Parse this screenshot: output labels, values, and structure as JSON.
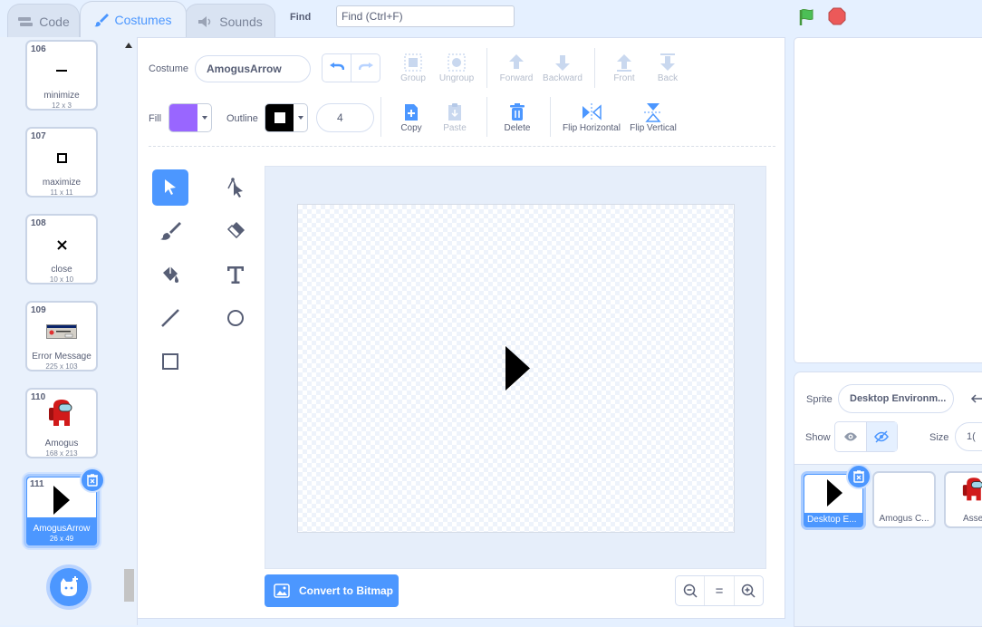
{
  "tabs": [
    {
      "label": "Code",
      "icon": "code-icon"
    },
    {
      "label": "Costumes",
      "icon": "brush-icon"
    },
    {
      "label": "Sounds",
      "icon": "speaker-icon"
    }
  ],
  "find": {
    "label": "Find",
    "placeholder": "Find (Ctrl+F)"
  },
  "costumes": [
    {
      "number": "106",
      "name": "minimize",
      "dims": "12 x 3"
    },
    {
      "number": "107",
      "name": "maximize",
      "dims": "11 x 11"
    },
    {
      "number": "108",
      "name": "close",
      "dims": "10 x 10"
    },
    {
      "number": "109",
      "name": "Error Message",
      "dims": "225 x 103"
    },
    {
      "number": "110",
      "name": "Amogus",
      "dims": "168 x 213"
    },
    {
      "number": "111",
      "name": "AmogusArrow",
      "dims": "26 x 49"
    }
  ],
  "editor": {
    "costume_label": "Costume",
    "costume_name": "AmogusArrow",
    "group": "Group",
    "ungroup": "Ungroup",
    "forward": "Forward",
    "backward": "Backward",
    "front": "Front",
    "back": "Back",
    "fill_label": "Fill",
    "outline_label": "Outline",
    "outline_width": "4",
    "copy": "Copy",
    "paste": "Paste",
    "delete": "Delete",
    "flip_horizontal": "Flip Horizontal",
    "flip_vertical": "Flip Vertical",
    "convert_button": "Convert to Bitmap",
    "zoom_reset": "="
  },
  "colors": {
    "fill": "#9966ff",
    "outline": "#000000",
    "accent": "#4c97ff"
  },
  "sprite": {
    "label": "Sprite",
    "name": "Desktop Environm...",
    "show_label": "Show",
    "size_label": "Size",
    "size_value": "1(",
    "tiles": [
      {
        "name": "Desktop E..."
      },
      {
        "name": "Amogus C..."
      },
      {
        "name": "Asse"
      }
    ]
  }
}
